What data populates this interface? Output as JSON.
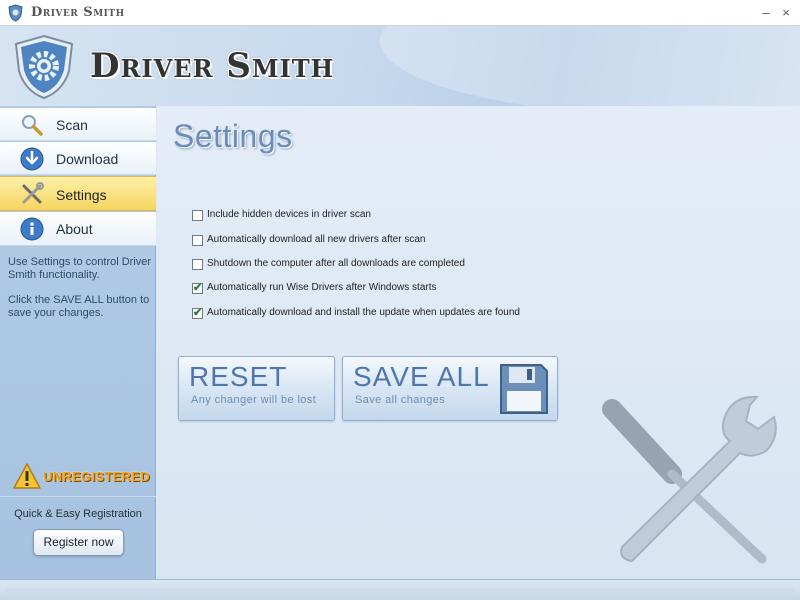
{
  "window": {
    "title": "Driver Smith"
  },
  "header": {
    "logo_text": "Driver Smith"
  },
  "sidebar": {
    "items": [
      {
        "label": "Scan",
        "icon": "magnifier-icon"
      },
      {
        "label": "Download",
        "icon": "download-arrow-icon"
      },
      {
        "label": "Settings",
        "icon": "tools-icon",
        "active": true
      },
      {
        "label": "About",
        "icon": "info-icon"
      }
    ],
    "help_text_1": "Use Settings to control Driver Smith functionality.",
    "help_text_2": "Click the SAVE ALL button to save your changes.",
    "unregistered_label": "UNREGISTERED",
    "quick_registration": "Quick & Easy Registration",
    "register_button": "Register now"
  },
  "main": {
    "title": "Settings",
    "options": [
      {
        "label": "Include hidden devices in driver scan",
        "checked": false
      },
      {
        "label": "Automatically download all new drivers after scan",
        "checked": false
      },
      {
        "label": "Shutdown the computer after all downloads are completed",
        "checked": false
      },
      {
        "label": "Automatically run Wise Drivers after Windows starts",
        "checked": true
      },
      {
        "label": "Automatically download and install the update when updates are found",
        "checked": true
      }
    ],
    "reset_button": {
      "title": "RESET",
      "subtitle": "Any changer will be lost"
    },
    "save_button": {
      "title": "SAVE ALL",
      "subtitle": "Save all changes"
    }
  },
  "colors": {
    "accent": "#4c78ad",
    "active_nav": "#f6d460",
    "warning": "#f4a21c"
  }
}
